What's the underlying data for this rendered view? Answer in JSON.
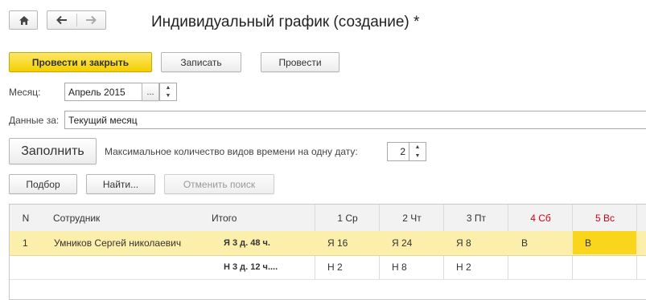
{
  "window": {
    "title": "Индивидуальный график (создание) *"
  },
  "nav": {
    "home_icon": "home-icon",
    "back_icon": "arrow-left-icon",
    "forward_icon": "arrow-right-icon"
  },
  "toolbar": {
    "post_close_label": "Провести и закрыть",
    "save_label": "Записать",
    "post_label": "Провести"
  },
  "form": {
    "month_label": "Месяц:",
    "month_value": "Апрель 2015",
    "month_select_label": "...",
    "data_for_label": "Данные за:",
    "data_for_value": "Текущий месяц",
    "fill_label": "Заполнить",
    "max_types_label": "Максимальное количество видов времени на одну дату:",
    "max_types_value": "2"
  },
  "list_toolbar": {
    "pick_label": "Подбор",
    "find_label": "Найти...",
    "cancel_search_label": "Отменить поиск"
  },
  "table": {
    "headers": {
      "n": "N",
      "employee": "Сотрудник",
      "total": "Итого",
      "d1": "1 Ср",
      "d2": "2 Чт",
      "d3": "3 Пт",
      "d4": "4 Сб",
      "d5": "5 Вс"
    },
    "rows": [
      {
        "n": "1",
        "employee": "Умников Сергей николаевич",
        "total": "Я 3 д. 48 ч.",
        "d1": "Я 16",
        "d2": "Я 24",
        "d3": "Я 8",
        "d4": "В",
        "d5": "В"
      },
      {
        "n": "",
        "employee": "",
        "total": "Н 3 д. 12 ч....",
        "d1": "Н 2",
        "d2": "Н 8",
        "d3": "Н 2",
        "d4": "",
        "d5": ""
      }
    ],
    "weekend_color": "#d0021b",
    "selected_row_color": "#fcefab",
    "active_cell_color": "#f9d51c"
  }
}
